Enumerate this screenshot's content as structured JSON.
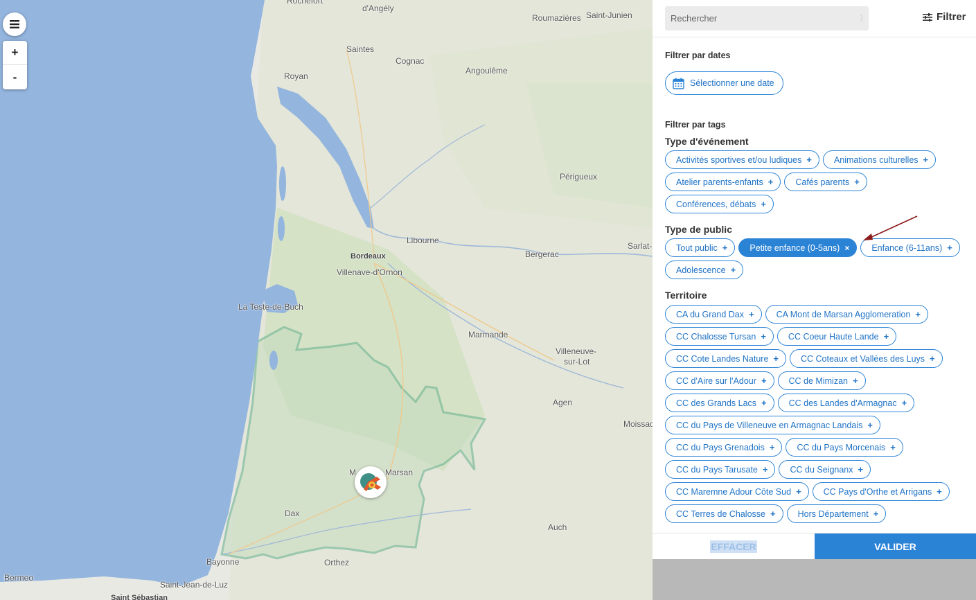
{
  "map": {
    "menu_icon": "hamburger-icon",
    "zoom_in": "+",
    "zoom_out": "-",
    "marker_icon": "event-marker-icon",
    "labels": {
      "rochefort": "Rochefort",
      "angely": "d'Angély",
      "roumazieres": "Roumazières",
      "saint_junien": "Saint-Junien",
      "saintes": "Saintes",
      "cognac": "Cognac",
      "angouleme": "Angoulême",
      "royan": "Royan",
      "perigueux": "Périgueux",
      "libourne": "Libourne",
      "bordeaux": "Bordeaux",
      "villenave": "Villenave-d'Ornon",
      "bergerac": "Bergerac",
      "sarlat": "Sarlat-",
      "la_teste": "La Teste-de-Buch",
      "marmande": "Marmande",
      "villeneuve": "Villeneuve-",
      "villeneuve2": "sur-Lot",
      "agen": "Agen",
      "moissac": "Moissac",
      "mont_marsan_a": "M",
      "mont_marsan_b": "Marsan",
      "dax": "Dax",
      "auch": "Auch",
      "bayonne": "Bayonne",
      "orthez": "Orthez",
      "bermeo": "Bermeo",
      "saint_jean": "Saint-Jean-de-Luz",
      "saint_sebastian": "Saint Sébastian"
    }
  },
  "panel": {
    "search": {
      "placeholder": "Rechercher"
    },
    "filter_label": "Filtrer",
    "filter_icon": "sliders-icon",
    "dates": {
      "title": "Filtrer par dates",
      "button_label": "Sélectionner une date",
      "icon": "calendar-icon"
    },
    "tags_title": "Filtrer par tags",
    "groups": [
      {
        "title": "Type d'événement",
        "tags": [
          {
            "label": "Activités sportives et/ou ludiques",
            "active": false
          },
          {
            "label": "Animations culturelles",
            "active": false
          },
          {
            "label": "Atelier parents-enfants",
            "active": false
          },
          {
            "label": "Cafés parents",
            "active": false
          },
          {
            "label": "Conférences, débats",
            "active": false
          }
        ]
      },
      {
        "title": "Type de public",
        "tags": [
          {
            "label": "Tout public",
            "active": false
          },
          {
            "label": "Petite enfance (0-5ans)",
            "active": true
          },
          {
            "label": "Enfance (6-11ans)",
            "active": false
          },
          {
            "label": "Adolescence",
            "active": false
          }
        ]
      },
      {
        "title": "Territoire",
        "tags": [
          {
            "label": "CA du Grand Dax",
            "active": false
          },
          {
            "label": "CA Mont de Marsan Agglomeration",
            "active": false
          },
          {
            "label": "CC Chalosse Tursan",
            "active": false
          },
          {
            "label": "CC Coeur Haute Lande",
            "active": false
          },
          {
            "label": "CC Cote Landes Nature",
            "active": false
          },
          {
            "label": "CC Coteaux et Vallées des Luys",
            "active": false
          },
          {
            "label": "CC d'Aire sur l'Adour",
            "active": false
          },
          {
            "label": "CC de Mimizan",
            "active": false
          },
          {
            "label": "CC des Grands Lacs",
            "active": false
          },
          {
            "label": "CC des Landes d'Armagnac",
            "active": false
          },
          {
            "label": "CC du Pays de Villeneuve en Armagnac Landais",
            "active": false
          },
          {
            "label": "CC du Pays Grenadois",
            "active": false
          },
          {
            "label": "CC du Pays Morcenais",
            "active": false
          },
          {
            "label": "CC du Pays Tarusate",
            "active": false
          },
          {
            "label": "CC du Seignanx",
            "active": false
          },
          {
            "label": "CC Maremne Adour Côte Sud",
            "active": false
          },
          {
            "label": "CC Pays d'Orthe et Arrigans",
            "active": false
          },
          {
            "label": "CC Terres de Chalosse",
            "active": false
          },
          {
            "label": "Hors Département",
            "active": false
          }
        ]
      }
    ],
    "add_symbol": "+",
    "remove_symbol": "×",
    "actions": {
      "clear": "EFFACER",
      "validate": "VALIDER"
    }
  },
  "colors": {
    "accent": "#2b83d6",
    "sea": "#94b5de",
    "territory_border": "#5fae8a",
    "arrow": "#8b1a1a"
  }
}
